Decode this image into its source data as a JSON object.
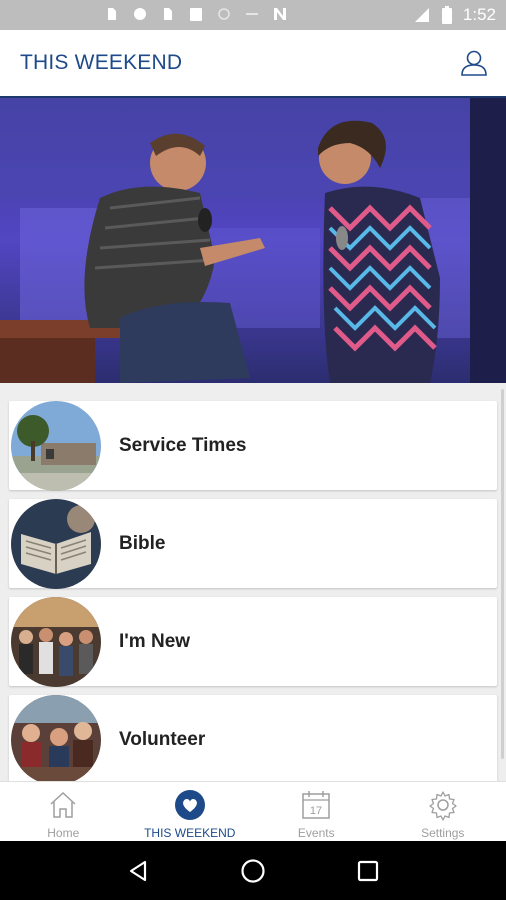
{
  "status_bar": {
    "time": "1:52"
  },
  "header": {
    "title": "THIS WEEKEND",
    "profile_icon": "person-outline-icon"
  },
  "hero": {
    "image": "two-speakers-on-stage-photo"
  },
  "list": {
    "items": [
      {
        "label": "Service Times",
        "thumb": "church-building-photo"
      },
      {
        "label": "Bible",
        "thumb": "open-bible-photo"
      },
      {
        "label": "I'm New",
        "thumb": "crowd-photo"
      },
      {
        "label": "Volunteer",
        "thumb": "volunteers-photo"
      }
    ]
  },
  "tabbar": {
    "tabs": [
      {
        "label": "Home",
        "icon": "home-icon"
      },
      {
        "label": "THIS WEEKEND",
        "icon": "heart-circle-icon",
        "active": true
      },
      {
        "label": "Events",
        "icon": "calendar-icon",
        "day": "17"
      },
      {
        "label": "Settings",
        "icon": "gear-icon"
      }
    ]
  },
  "colors": {
    "brand": "#1e4a8a",
    "tab_inactive": "#9e9e9e",
    "list_bg": "#eeeeee"
  }
}
